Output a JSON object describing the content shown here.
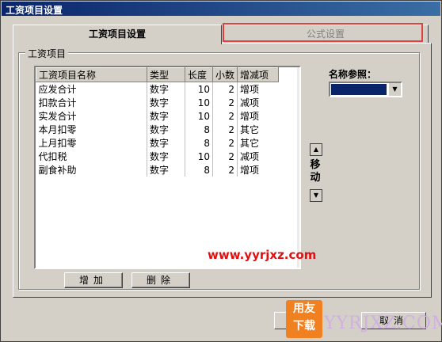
{
  "window": {
    "title": "工资项目设置"
  },
  "tabs": [
    {
      "label": "工资项目设置",
      "active": true
    },
    {
      "label": "公式设置",
      "active": false
    }
  ],
  "group": {
    "legend": "工资项目"
  },
  "table": {
    "headers": [
      "工资项目名称",
      "类型",
      "长度",
      "小数",
      "增减项"
    ],
    "rows": [
      [
        "应发合计",
        "数字",
        "10",
        "2",
        "增项"
      ],
      [
        "扣款合计",
        "数字",
        "10",
        "2",
        "减项"
      ],
      [
        "实发合计",
        "数字",
        "10",
        "2",
        "增项"
      ],
      [
        "本月扣零",
        "数字",
        "8",
        "2",
        "其它"
      ],
      [
        "上月扣零",
        "数字",
        "8",
        "2",
        "其它"
      ],
      [
        "代扣税",
        "数字",
        "10",
        "2",
        "减项"
      ],
      [
        "副食补助",
        "数字",
        "8",
        "2",
        "增项"
      ]
    ]
  },
  "buttons": {
    "add": "增加",
    "delete": "删除",
    "cancel": "取消"
  },
  "reference": {
    "label": "名称参照：",
    "selected": ""
  },
  "move": {
    "label": "移动"
  },
  "watermark": {
    "url": "www.yyrjxz.com",
    "logo_top": "用友",
    "logo_bottom": "下载",
    "logo_text": "YYRJXZ.COM"
  },
  "colors": {
    "titlebar": "#0a246a",
    "highlight": "#e04040",
    "watermark": "#e01010"
  }
}
